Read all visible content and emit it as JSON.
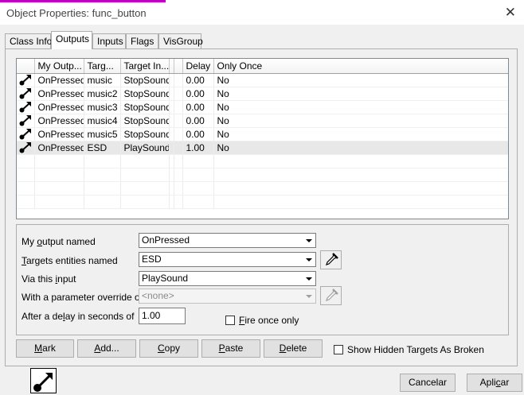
{
  "window": {
    "title": "Object Properties: func_button"
  },
  "tabs": [
    {
      "label": "Class Info",
      "active": false
    },
    {
      "label": "Outputs",
      "active": true
    },
    {
      "label": "Inputs",
      "active": false
    },
    {
      "label": "Flags",
      "active": false
    },
    {
      "label": "VisGroup",
      "active": false
    }
  ],
  "grid": {
    "columns": [
      "My Outp...",
      "Targ...",
      "Target In...",
      "Delay",
      "Only Once"
    ],
    "rows": [
      {
        "output": "OnPressed",
        "target": "music",
        "input": "StopSound",
        "delay": "0.00",
        "once": "No"
      },
      {
        "output": "OnPressed",
        "target": "music2",
        "input": "StopSound",
        "delay": "0.00",
        "once": "No"
      },
      {
        "output": "OnPressed",
        "target": "music3",
        "input": "StopSound",
        "delay": "0.00",
        "once": "No"
      },
      {
        "output": "OnPressed",
        "target": "music4",
        "input": "StopSound",
        "delay": "0.00",
        "once": "No"
      },
      {
        "output": "OnPressed",
        "target": "music5",
        "input": "StopSound",
        "delay": "0.00",
        "once": "No"
      },
      {
        "output": "OnPressed",
        "target": "ESD",
        "input": "PlaySound",
        "delay": "1.00",
        "once": "No"
      }
    ],
    "selected_row": 5
  },
  "form": {
    "output_label_pre": "My ",
    "output_label_key": "o",
    "output_label_post": "utput named",
    "output_value": "OnPressed",
    "targets_label_key": "T",
    "targets_label_post": "argets entities named",
    "targets_value": "ESD",
    "input_label_pre": "Via this ",
    "input_label_key": "i",
    "input_label_post": "nput",
    "input_value": "PlaySound",
    "param_label": "With a parameter override of",
    "param_value": "<none>",
    "delay_label_pre": "After a de",
    "delay_label_key": "l",
    "delay_label_post": "ay in seconds of",
    "delay_value": "1.00",
    "fire_once_key": "F",
    "fire_once_post": "ire once only"
  },
  "buttons": {
    "mark_key": "M",
    "mark_post": "ark",
    "add_key": "A",
    "add_post": "dd...",
    "copy_key": "C",
    "copy_post": "opy",
    "paste_key": "P",
    "paste_post": "aste",
    "delete_key": "D",
    "delete_post": "elete",
    "show_hidden": "Show Hidden Targets As Broken",
    "cancel": "Cancelar",
    "apply_pre": "Apli",
    "apply_key": "c",
    "apply_post": "ar"
  }
}
